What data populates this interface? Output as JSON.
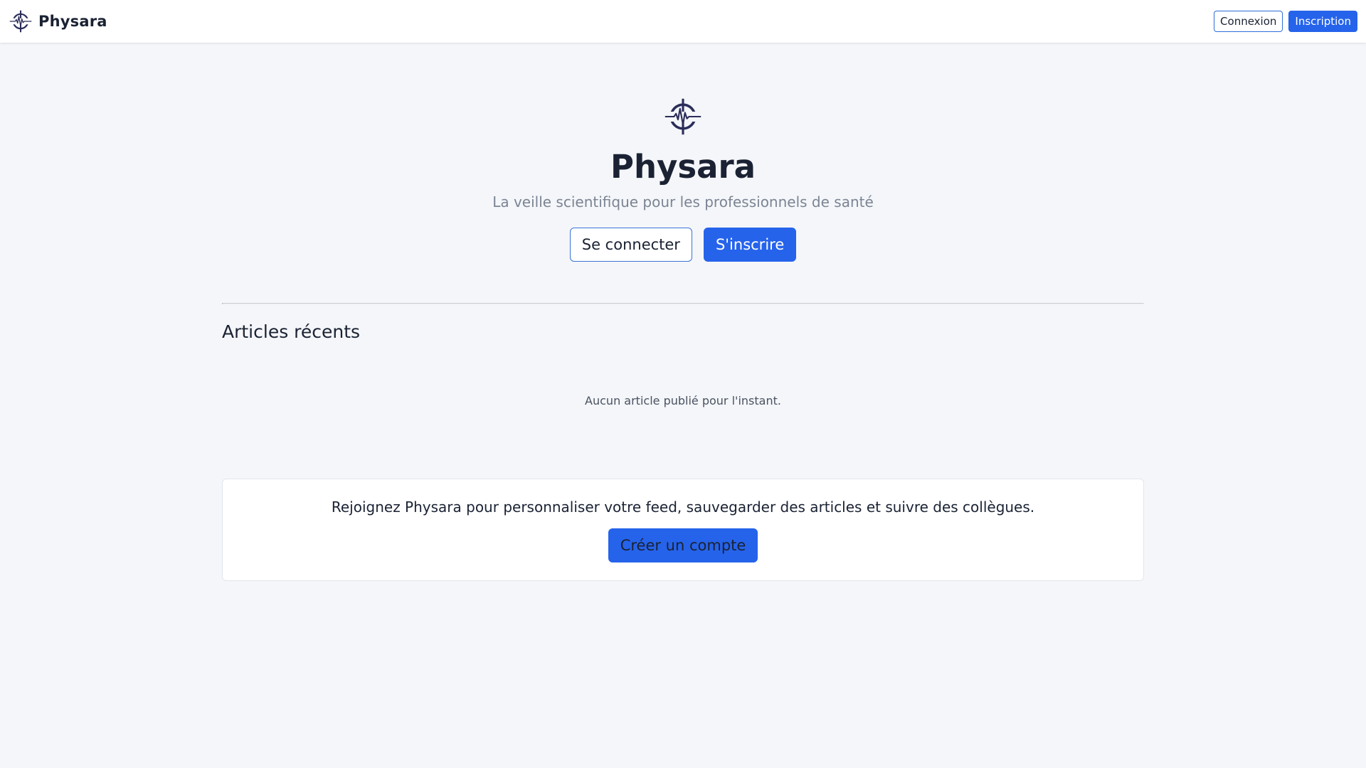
{
  "navbar": {
    "brand_name": "Physara",
    "login_label": "Connexion",
    "signup_label": "Inscription"
  },
  "hero": {
    "title": "Physara",
    "subtitle": "La veille scientifique pour les professionnels de santé",
    "login_label": "Se connecter",
    "signup_label": "S'inscrire"
  },
  "articles": {
    "section_title": "Articles récents",
    "empty_message": "Aucun article publié pour l'instant."
  },
  "cta": {
    "text": "Rejoignez Physara pour personnaliser votre feed, sauvegarder des articles et suivre des collègues.",
    "button_label": "Créer un compte"
  },
  "colors": {
    "primary": "#2563eb",
    "background": "#f4f6f9",
    "text": "#1a2233",
    "muted": "#7b8494",
    "logo": "#2b2d5a"
  },
  "icons": {
    "logo": "heartbeat-crosshair-logo"
  }
}
